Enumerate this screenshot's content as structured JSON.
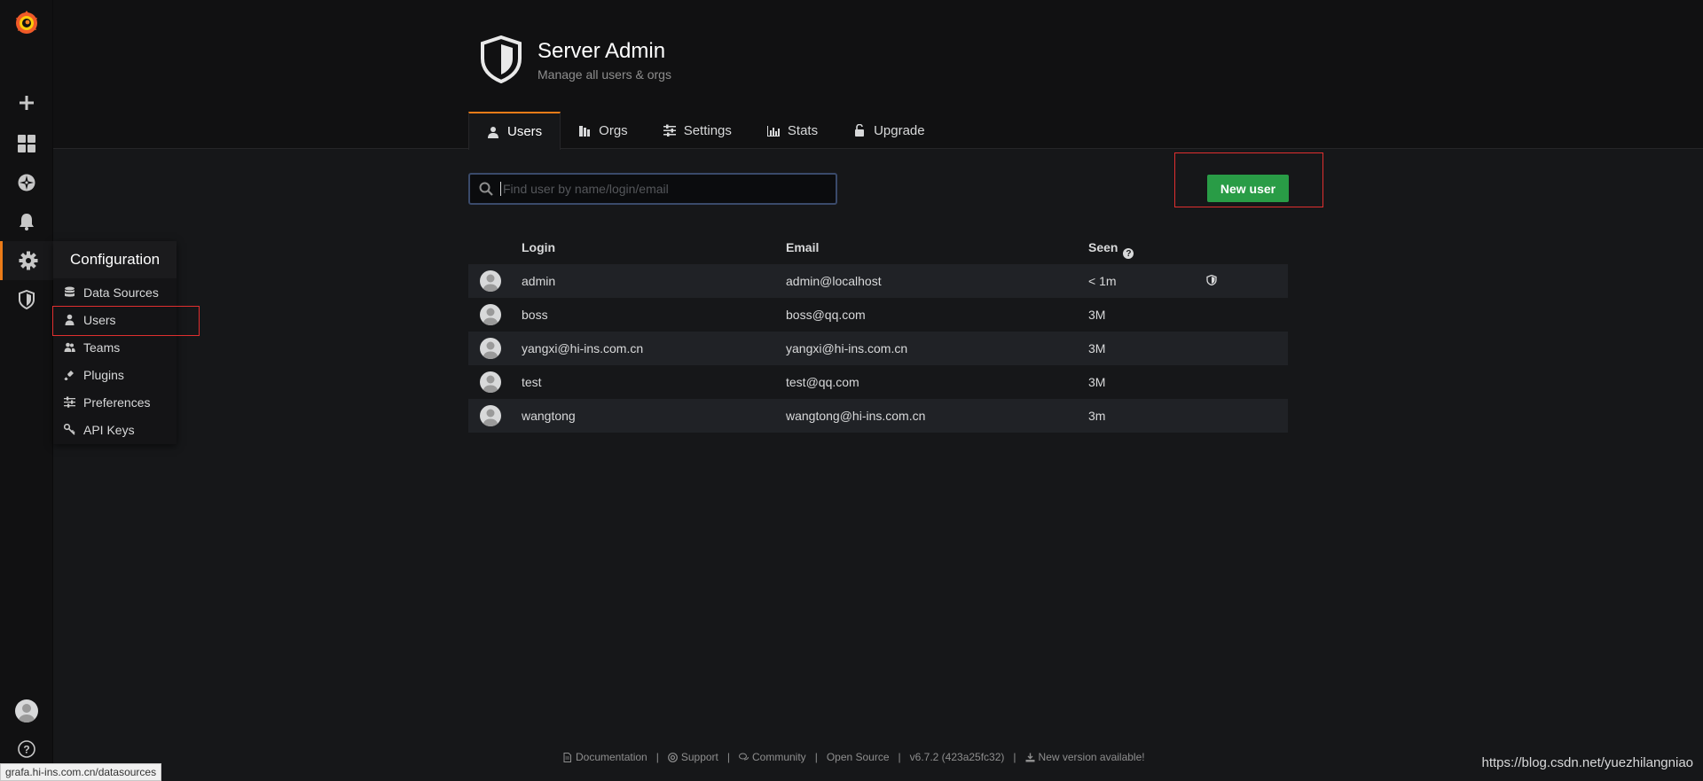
{
  "header": {
    "title": "Server Admin",
    "subtitle": "Manage all users & orgs"
  },
  "tabs": [
    {
      "label": "Users",
      "icon": "user-icon",
      "active": true
    },
    {
      "label": "Orgs",
      "icon": "orgs-icon",
      "active": false
    },
    {
      "label": "Settings",
      "icon": "sliders-icon",
      "active": false
    },
    {
      "label": "Stats",
      "icon": "bar-chart-icon",
      "active": false
    },
    {
      "label": "Upgrade",
      "icon": "unlock-icon",
      "active": false
    }
  ],
  "config_menu": {
    "title": "Configuration",
    "items": [
      {
        "label": "Data Sources",
        "icon": "database-icon"
      },
      {
        "label": "Users",
        "icon": "user-icon"
      },
      {
        "label": "Teams",
        "icon": "users-icon"
      },
      {
        "label": "Plugins",
        "icon": "plug-icon"
      },
      {
        "label": "Preferences",
        "icon": "sliders-icon"
      },
      {
        "label": "API Keys",
        "icon": "key-icon"
      }
    ]
  },
  "search": {
    "placeholder": "Find user by name/login/email",
    "value": ""
  },
  "new_user_label": "New user",
  "table": {
    "headers": {
      "login": "Login",
      "email": "Email",
      "seen": "Seen"
    },
    "rows": [
      {
        "login": "admin",
        "email": "admin@localhost",
        "seen": "< 1m",
        "is_admin": true
      },
      {
        "login": "boss",
        "email": "boss@qq.com",
        "seen": "3M",
        "is_admin": false
      },
      {
        "login": "yangxi@hi-ins.com.cn",
        "email": "yangxi@hi-ins.com.cn",
        "seen": "3M",
        "is_admin": false
      },
      {
        "login": "test",
        "email": "test@qq.com",
        "seen": "3M",
        "is_admin": false
      },
      {
        "login": "wangtong",
        "email": "wangtong@hi-ins.com.cn",
        "seen": "3m",
        "is_admin": false
      }
    ]
  },
  "footer": {
    "documentation": "Documentation",
    "support": "Support",
    "community": "Community",
    "open_source": "Open Source",
    "version": "v6.7.2 (423a25fc32)",
    "new_version": "New version available!"
  },
  "status_url": "grafa.hi-ins.com.cn/datasources",
  "watermark": "https://blog.csdn.net/yuezhilangniao",
  "colors": {
    "accent": "#eb7b18",
    "primary_button": "#299c46",
    "highlight_box": "#e02f2f"
  }
}
